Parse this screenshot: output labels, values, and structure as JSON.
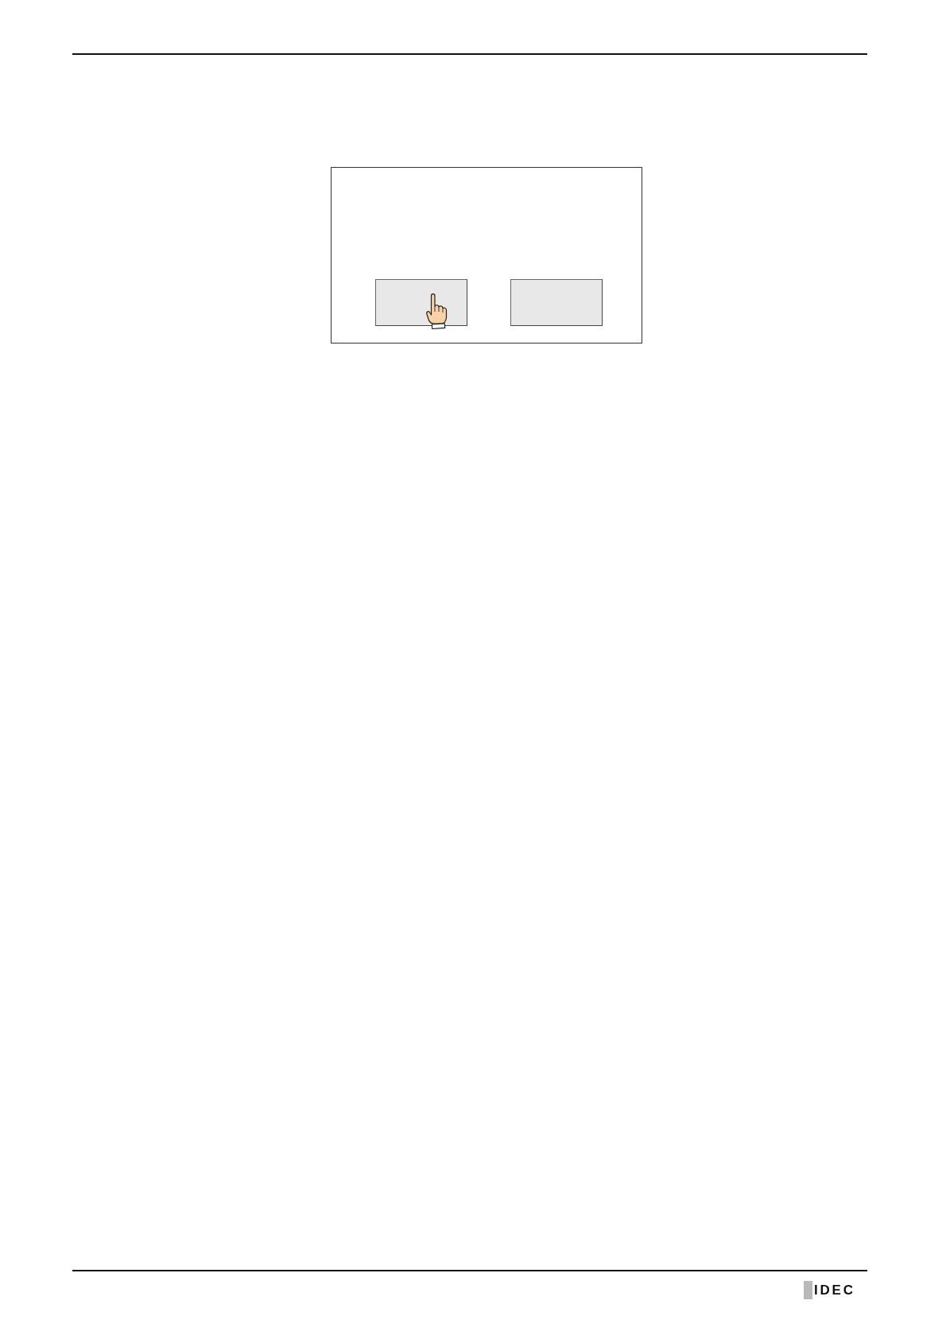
{
  "figure": {
    "buttons": [
      {
        "touched": true
      },
      {
        "touched": false
      }
    ]
  },
  "footer": {
    "logo": "IDEC"
  }
}
